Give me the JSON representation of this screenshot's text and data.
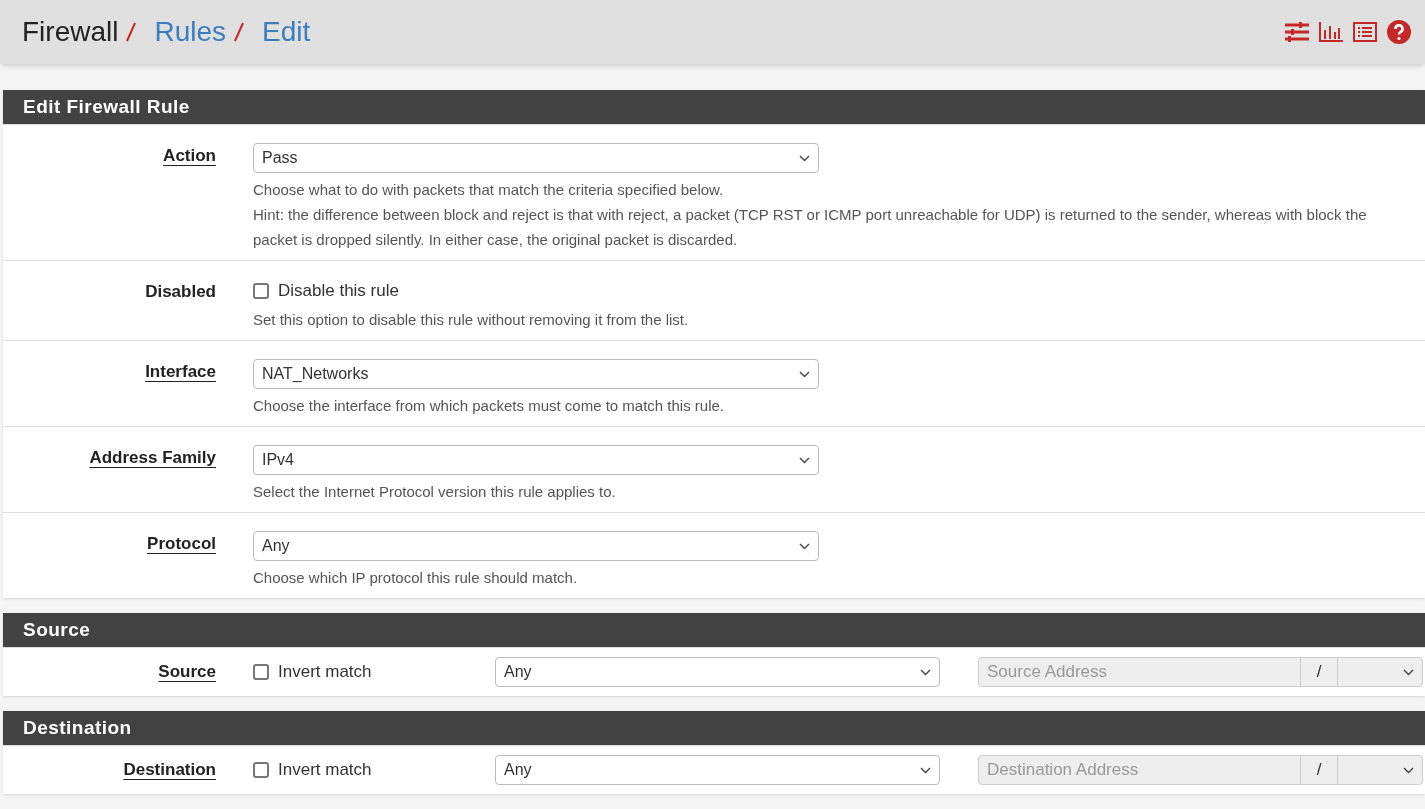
{
  "breadcrumb": [
    {
      "text": "Firewall",
      "kind": "text"
    },
    {
      "text": "Rules",
      "kind": "link"
    },
    {
      "text": "Edit",
      "kind": "link"
    }
  ],
  "sections": [
    {
      "title": "Edit Firewall Rule",
      "rows": [
        {
          "kind": "select",
          "label": "Action",
          "linked": true,
          "value": "Pass",
          "help": [
            "Choose what to do with packets that match the criteria specified below.",
            "Hint: the difference between block and reject is that with reject, a packet (TCP RST or ICMP port unreachable for UDP) is returned to the sender, whereas with block the packet is dropped silently. In either case, the original packet is discarded."
          ]
        },
        {
          "kind": "checkbox",
          "label": "Disabled",
          "linked": false,
          "checked": false,
          "checkbox_label": "Disable this rule",
          "help": [
            "Set this option to disable this rule without removing it from the list."
          ]
        },
        {
          "kind": "select",
          "label": "Interface",
          "linked": true,
          "value": "NAT_Networks",
          "help": [
            "Choose the interface from which packets must come to match this rule."
          ]
        },
        {
          "kind": "select",
          "label": "Address Family",
          "linked": true,
          "value": "IPv4",
          "help": [
            "Select the Internet Protocol version this rule applies to."
          ]
        },
        {
          "kind": "select",
          "label": "Protocol",
          "linked": true,
          "value": "Any",
          "help": [
            "Choose which IP protocol this rule should match."
          ]
        }
      ]
    },
    {
      "title": "Source",
      "rows": [
        {
          "kind": "address",
          "label": "Source",
          "linked": true,
          "checked": false,
          "checkbox_label": "Invert match",
          "value": "Any",
          "placeholder": "Source Address",
          "separator": "/"
        }
      ]
    },
    {
      "title": "Destination",
      "rows": [
        {
          "kind": "address",
          "label": "Destination",
          "linked": true,
          "checked": false,
          "checkbox_label": "Invert match",
          "value": "Any",
          "placeholder": "Destination Address",
          "separator": "/"
        }
      ]
    }
  ]
}
